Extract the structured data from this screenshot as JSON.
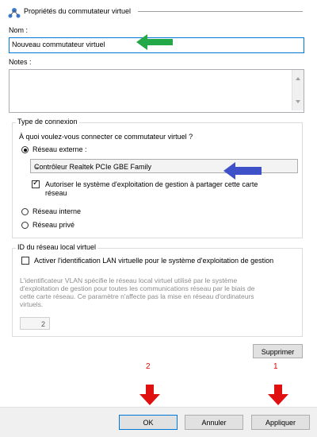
{
  "header": {
    "title": "Propriétés du commutateur virtuel"
  },
  "name": {
    "label": "Nom :",
    "value": "Nouveau commutateur virtuel"
  },
  "notes": {
    "label": "Notes :",
    "value": ""
  },
  "connection": {
    "group_title": "Type de connexion",
    "question": "À quoi voulez-vous connecter ce commutateur virtuel ?",
    "options": [
      {
        "label": "Réseau externe :",
        "checked": true
      },
      {
        "label": "Réseau interne",
        "checked": false
      },
      {
        "label": "Réseau privé",
        "checked": false
      }
    ],
    "adapter_selected": "Contrôleur Realtek PCIe GBE Family",
    "allow_mgmt_os": {
      "label_line1": "Autoriser le système d'exploitation de gestion à partager cette carte",
      "label_line2": "réseau",
      "checked": true
    }
  },
  "vlan": {
    "group_title": "ID du réseau local virtuel",
    "enable_label": "Activer l'identification LAN virtuelle pour le système d'exploitation de gestion",
    "enabled": false,
    "description_lines": [
      "L'identificateur VLAN spécifie le réseau local virtuel utilisé par le système",
      "d'exploitation de gestion pour toutes les communications réseau par le biais de",
      "cette carte réseau. Ce paramètre n'affecte pas la mise en réseau d'ordinateurs",
      "virtuels."
    ],
    "id_value": "2"
  },
  "buttons": {
    "delete": "Supprimer",
    "ok": "OK",
    "cancel": "Annuler",
    "apply": "Appliquer"
  },
  "annotations": {
    "step1": "1",
    "step2": "2",
    "arrow_colors": {
      "green": "#22a847",
      "blue": "#3f51c8",
      "red": "#e01010"
    }
  }
}
